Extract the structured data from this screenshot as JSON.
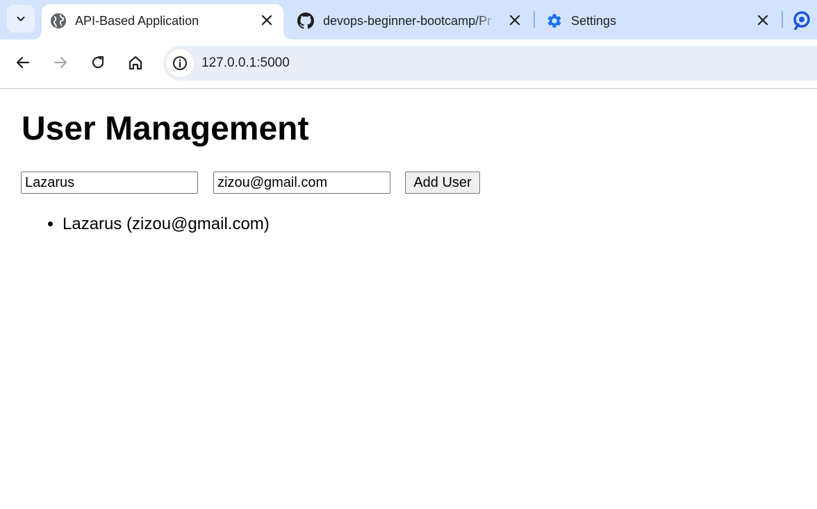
{
  "browser": {
    "tabs": [
      {
        "title": "API-Based Application",
        "icon": "globe-icon",
        "active": true
      },
      {
        "title": "devops-beginner-bootcamp/Pr",
        "icon": "github-icon",
        "active": false
      },
      {
        "title": "Settings",
        "icon": "gear-icon",
        "active": false
      }
    ],
    "address": {
      "url": "127.0.0.1:5000"
    }
  },
  "page": {
    "heading": "User Management",
    "form": {
      "name_value": "Lazarus",
      "email_value": "zizou@gmail.com",
      "add_label": "Add User"
    },
    "users": [
      {
        "text": "Lazarus (zizou@gmail.com)"
      }
    ]
  },
  "colors": {
    "tabstrip_bg": "#d3e3fd",
    "omnibox_bg": "#e9eef6",
    "settings_icon": "#1a73e8"
  }
}
